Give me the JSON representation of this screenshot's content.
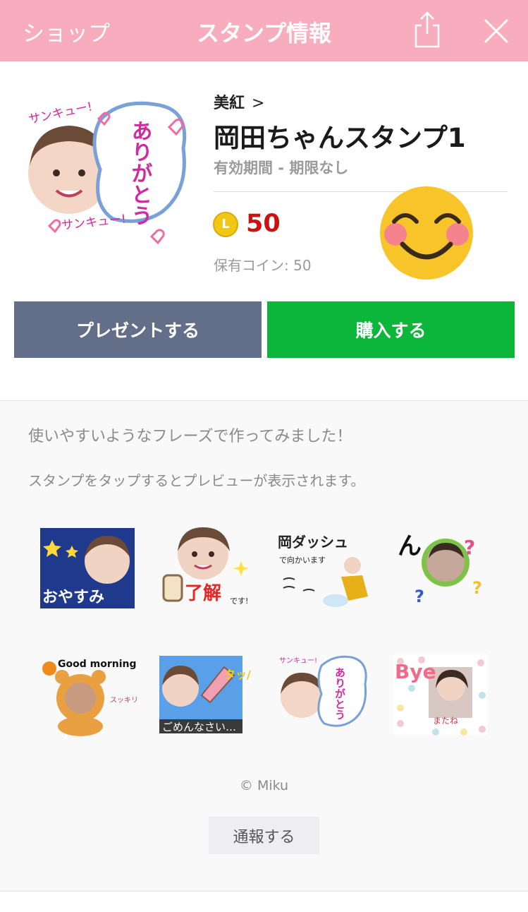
{
  "header": {
    "back_label": "ショップ",
    "title": "スタンプ情報"
  },
  "product": {
    "author": "美紅",
    "title": "岡田ちゃんスタンプ1",
    "validity": "有効期間 - 期限なし",
    "coin_symbol": "L",
    "price": "50",
    "owned_coins": "保有コイン: 50",
    "main_image_text": {
      "top": "サンキュー!",
      "bubble": "ありがとう",
      "bottom": "サンキュー!"
    }
  },
  "buttons": {
    "present": "プレゼントする",
    "buy": "購入する"
  },
  "description": {
    "line1": "使いやすいようなフレーズで作ってみました！",
    "line2": "スタンプをタップするとプレビューが表示されます。"
  },
  "stamps": [
    {
      "text": "おやすみ",
      "icon": "stars"
    },
    {
      "text": "了解",
      "sub": "です!",
      "icon": "thumbs-up"
    },
    {
      "text": "岡ダッシュ",
      "sub": "で向かいます",
      "icon": "running"
    },
    {
      "text": "ん",
      "icon": "question-marks"
    },
    {
      "text": "Good morning",
      "sub": "スッキリ",
      "icon": "bear-costume"
    },
    {
      "text": "ごめんなさい…",
      "sub": "タッ/",
      "icon": "tears"
    },
    {
      "text": "ありがとう",
      "sub": "サンキュー!",
      "icon": "hearts"
    },
    {
      "text": "Bye",
      "sub": "またね",
      "icon": "polka-dots"
    }
  ],
  "footer": {
    "copyright": "© Miku",
    "report_label": "通報する"
  },
  "colors": {
    "header": "#f8adbf",
    "present_button": "#636f88",
    "buy_button": "#0bb63b",
    "price": "#cc1111"
  }
}
